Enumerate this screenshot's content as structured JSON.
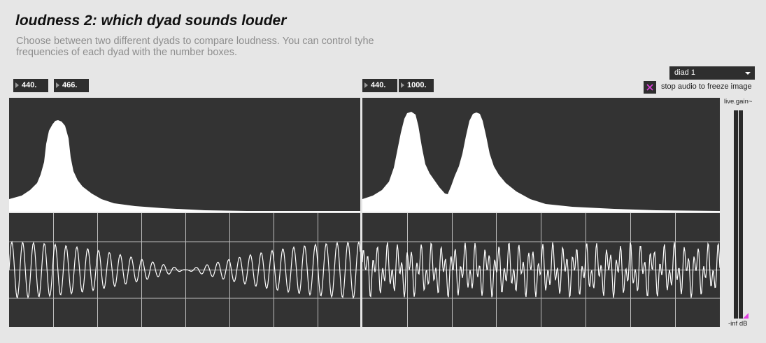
{
  "header": {
    "title": "loudness 2: which dyad sounds louder",
    "description": "Choose between two different dyads to compare loudness. You can control tyhe frequencies of each dyad with the number boxes."
  },
  "dyad1": {
    "freq_a": "440.",
    "freq_b": "466."
  },
  "dyad2": {
    "freq_a": "440.",
    "freq_b": "1000."
  },
  "controls": {
    "dyad_menu_value": "diad 1",
    "freeze_toggle_label": "stop audio to freeze image",
    "freeze_toggle_checked": true
  },
  "gain": {
    "label": "live.gain~",
    "value_text": "-inf dB"
  },
  "colors": {
    "panel": "#333333",
    "trace": "#ffffff",
    "grid": "#bdbdbd",
    "toggle_x": "#e040e0",
    "gain_indicator": "#e040e0"
  }
}
